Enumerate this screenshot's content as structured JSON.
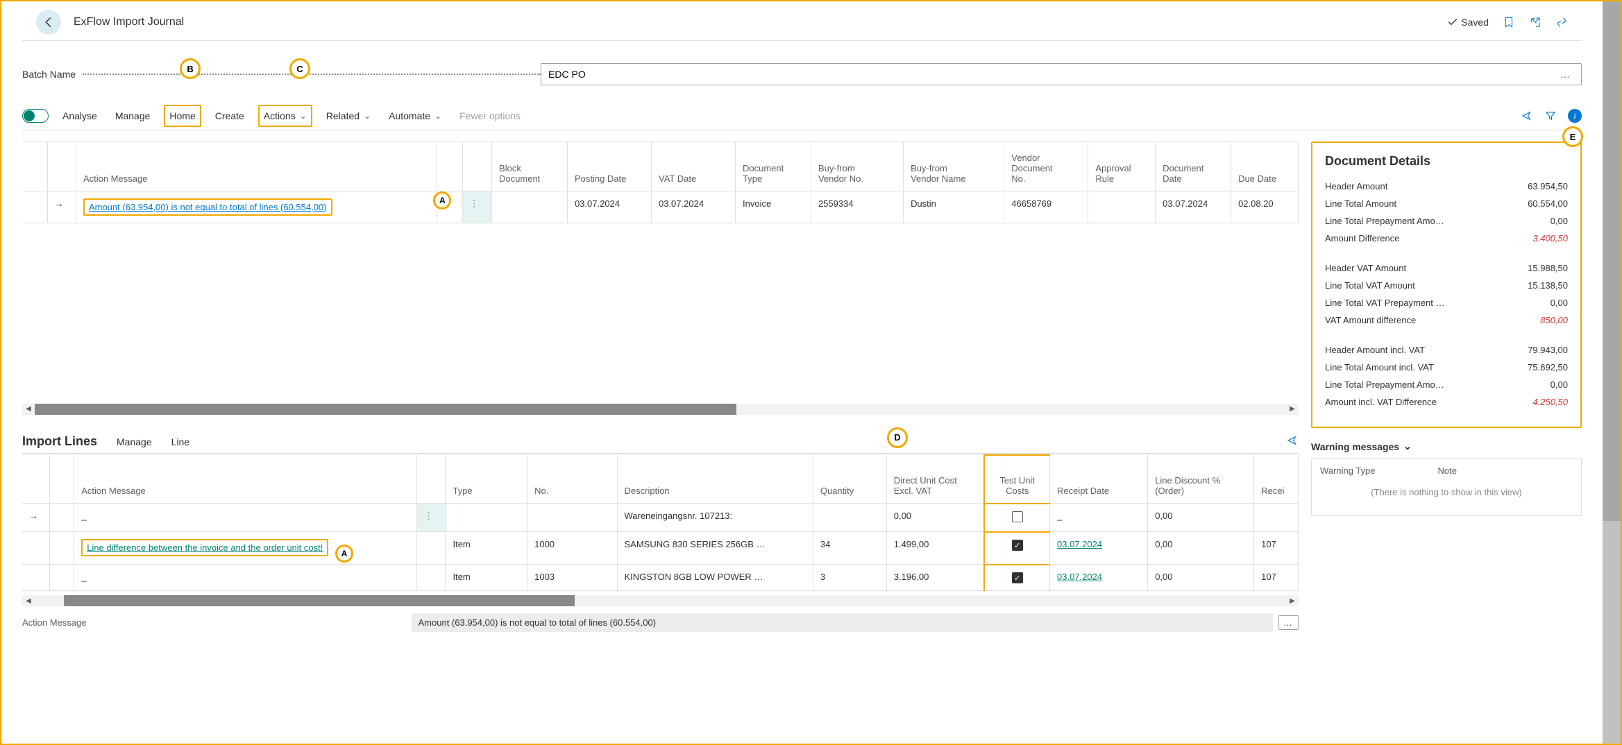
{
  "page": {
    "title": "ExFlow Import Journal",
    "saved_label": "Saved"
  },
  "batch": {
    "label": "Batch Name",
    "value": "EDC PO"
  },
  "actionbar": {
    "analyse": "Analyse",
    "manage": "Manage",
    "home": "Home",
    "create": "Create",
    "actions": "Actions",
    "related": "Related",
    "automate": "Automate",
    "fewer": "Fewer options"
  },
  "callouts": {
    "A": "A",
    "B": "B",
    "C": "C",
    "D": "D",
    "E": "E"
  },
  "headerGrid": {
    "columns": [
      "",
      "",
      "Action Message",
      "",
      "",
      "Block Document",
      "Posting Date",
      "VAT Date",
      "Document Type",
      "Buy-from Vendor No.",
      "Buy-from Vendor Name",
      "Vendor Document No.",
      "Approval Rule",
      "Document Date",
      "Due Date"
    ],
    "row": {
      "action_message": "Amount (63.954,00) is not equal to total of lines (60.554,00)",
      "posting_date": "03.07.2024",
      "vat_date": "03.07.2024",
      "doc_type": "Invoice",
      "vendor_no": "2559334",
      "vendor_name": "Dustin",
      "vendor_doc_no": "46658769",
      "approval_rule": "",
      "document_date": "03.07.2024",
      "due_date": "02.08.20"
    }
  },
  "importLines": {
    "title": "Import Lines",
    "tabs": {
      "manage": "Manage",
      "line": "Line"
    },
    "columns": [
      "",
      "",
      "Action Message",
      "",
      "Type",
      "No.",
      "Description",
      "Quantity",
      "Direct Unit Cost Excl. VAT",
      "Test Unit Costs",
      "Receipt Date",
      "Line Discount % (Order)",
      "Recei"
    ],
    "rows": [
      {
        "am_short": "_",
        "action_message": "",
        "type": "",
        "no": "",
        "description": "Wareneingangsnr. 107213:",
        "qty": "",
        "unit_cost": "0,00",
        "test": false,
        "receipt": "_",
        "disc": "0,00",
        "r": ""
      },
      {
        "am_short": "_",
        "action_message": "Line difference between the invoice and the order unit cost!",
        "type": "Item",
        "no": "1000",
        "description": "SAMSUNG 830 SERIES 256GB …",
        "qty": "34",
        "unit_cost": "1.499,00",
        "test": true,
        "receipt": "03.07.2024",
        "disc": "0,00",
        "r": "107"
      },
      {
        "am_short": "_",
        "action_message": "",
        "type": "Item",
        "no": "1003",
        "description": "KINGSTON 8GB LOW POWER …",
        "qty": "3",
        "unit_cost": "3.196,00",
        "test": true,
        "receipt": "03.07.2024",
        "disc": "0,00",
        "r": "107"
      }
    ]
  },
  "factbox": {
    "title": "Document Details",
    "rows1": [
      {
        "label": "Header Amount",
        "value": "63.954,50",
        "red": false
      },
      {
        "label": "Line Total Amount",
        "value": "60.554,00",
        "red": false
      },
      {
        "label": "Line Total Prepayment Amo…",
        "value": "0,00",
        "red": false
      },
      {
        "label": "Amount Difference",
        "value": "3.400,50",
        "red": true
      }
    ],
    "rows2": [
      {
        "label": "Header VAT Amount",
        "value": "15.988,50",
        "red": false
      },
      {
        "label": "Line Total VAT Amount",
        "value": "15.138,50",
        "red": false
      },
      {
        "label": "Line Total VAT Prepayment …",
        "value": "0,00",
        "red": false
      },
      {
        "label": "VAT Amount difference",
        "value": "850,00",
        "red": true
      }
    ],
    "rows3": [
      {
        "label": "Header Amount incl. VAT",
        "value": "79.943,00",
        "red": false
      },
      {
        "label": "Line Total Amount incl. VAT",
        "value": "75.692,50",
        "red": false
      },
      {
        "label": "Line Total Prepayment Amo…",
        "value": "0,00",
        "red": false
      },
      {
        "label": "Amount incl. VAT Difference",
        "value": "4.250,50",
        "red": true
      }
    ]
  },
  "warnings": {
    "title": "Warning messages",
    "col1": "Warning Type",
    "col2": "Note",
    "empty": "(There is nothing to show in this view)"
  },
  "bottom": {
    "label": "Action Message",
    "value": "Amount (63.954,00) is not equal to total of lines (60.554,00)"
  }
}
